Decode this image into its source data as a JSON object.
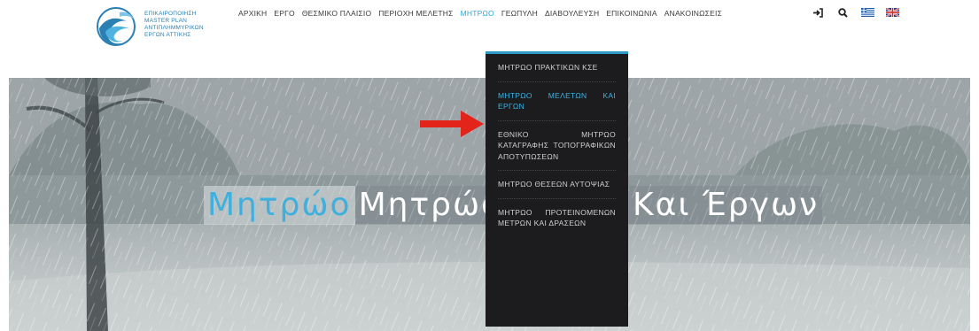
{
  "logo": {
    "lines": [
      "ΕΠΙΚΑΙΡΟΠΟΙΗΣΗ",
      "MASTER PLAN",
      "ΑΝΤΙΠΛΗΜΜΥΡΙΚΩΝ",
      "ΕΡΓΩΝ ΑΤΤΙΚΗΣ"
    ],
    "color": "#2a7fb3"
  },
  "nav": {
    "items": [
      {
        "label": "ΑΡΧΙΚΗ"
      },
      {
        "label": "ΕΡΓΟ"
      },
      {
        "label": "ΘΕΣΜΙΚΟ ΠΛΑΙΣΙΟ"
      },
      {
        "label": "ΠΕΡΙΟΧΗ ΜΕΛΕΤΗΣ"
      },
      {
        "label": "ΜΗΤΡΩΟ",
        "active": true
      },
      {
        "label": "ΓΕΩΠΥΛΗ"
      },
      {
        "label": "ΔΙΑΒΟΥΛΕΥΣΗ"
      },
      {
        "label": "ΕΠΙΚΟΙΝΩΝΙΑ"
      },
      {
        "label": "ΑΝΑΚΟΙΝΩΣΕΙΣ"
      }
    ],
    "icons": [
      "login-icon",
      "search-icon",
      "greek-flag-icon",
      "uk-flag-icon"
    ],
    "active_color": "#28a8d8"
  },
  "dropdown": {
    "items": [
      {
        "label": "ΜΗΤΡΩΟ ΠΡΑΚΤΙΚΩΝ ΚΣΕ"
      },
      {
        "label": "ΜΗΤΡΩΟ ΜΕΛΕΤΩΝ ΚΑΙ ΕΡΓΩΝ",
        "active": true
      },
      {
        "label": "ΕΘΝΙΚΟ ΜΗΤΡΩΟ ΚΑΤΑΓΡΑΦΗΣ ΤΟΠΟΓΡΑΦΙΚΩΝ ΑΠΟΤΥΠΩΣΕΩΝ"
      },
      {
        "label": "ΜΗΤΡΩΟ ΘΕΣΕΩΝ ΑΥΤΟΨΙΑΣ"
      },
      {
        "label": "ΜΗΤΡΩΟ ΠΡΟΤΕΙΝΟΜΕΝΩΝ ΜΕΤΡΩΝ ΚΑΙ ΔΡΑΣΕΩΝ"
      }
    ],
    "accent": "#2c99c6"
  },
  "hero": {
    "title_first": "Μητρώο",
    "title_second": "Μητρώο",
    "title_tail": "Και Έργων"
  },
  "annotation": {
    "arrow_color": "#e3241b"
  }
}
